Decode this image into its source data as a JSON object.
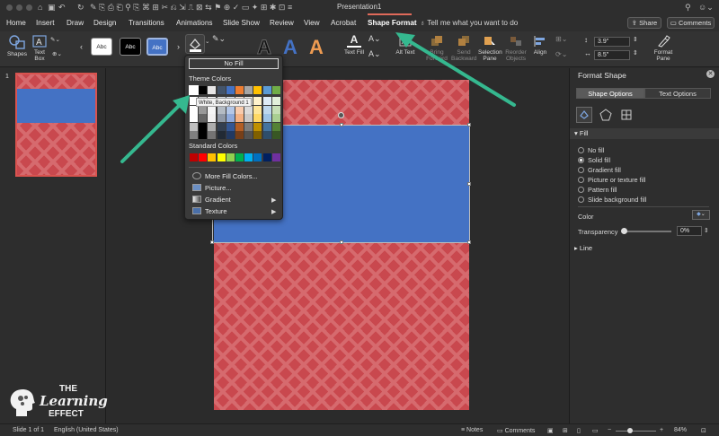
{
  "window": {
    "title": "Presentation1"
  },
  "menu": {
    "items": [
      "Home",
      "Insert",
      "Draw",
      "Design",
      "Transitions",
      "Animations",
      "Slide Show",
      "Review",
      "View",
      "Acrobat",
      "Shape Format"
    ],
    "active": "Shape Format",
    "tell_me": "Tell me what you want to do",
    "share": "Share",
    "comments": "Comments"
  },
  "ribbon": {
    "shapes": "Shapes",
    "text_box": "Text Box",
    "style_sample": "Abc",
    "text_fill": "Text Fill",
    "alt_text": "Alt Text",
    "bring_forward": "Bring Forward",
    "send_backward": "Send Backward",
    "selection_pane": "Selection Pane",
    "reorder_objects": "Reorder Objects",
    "align": "Align",
    "height": "3.9\"",
    "width": "8.5\"",
    "format_pane": "Format Pane"
  },
  "thumbnail": {
    "number": "1"
  },
  "fill_dropdown": {
    "no_fill": "No Fill",
    "theme_colors_label": "Theme Colors",
    "tooltip": "White, Background 1",
    "standard_colors_label": "Standard Colors",
    "theme_top_row": [
      "#ffffff",
      "#000000",
      "#e7e6e6",
      "#44546a",
      "#4472c4",
      "#ed7d31",
      "#a5a5a5",
      "#ffc000",
      "#5b9bd5",
      "#70ad47"
    ],
    "standard_colors": [
      "#c00000",
      "#ff0000",
      "#ffc000",
      "#ffff00",
      "#92d050",
      "#00b050",
      "#00b0f0",
      "#0070c0",
      "#002060",
      "#7030a0"
    ],
    "more_colors": "More Fill Colors...",
    "picture": "Picture...",
    "gradient": "Gradient",
    "texture": "Texture"
  },
  "format_pane": {
    "title": "Format Shape",
    "tab_shape": "Shape Options",
    "tab_text": "Text Options",
    "fill_section": "Fill",
    "options": [
      "No fill",
      "Solid fill",
      "Gradient fill",
      "Picture or texture fill",
      "Pattern fill",
      "Slide background fill"
    ],
    "selected_option": "Solid fill",
    "color_label": "Color",
    "transparency_label": "Transparency",
    "transparency_value": "0%",
    "line_section": "Line"
  },
  "status": {
    "slide": "Slide 1 of 1",
    "language": "English (United States)",
    "notes": "Notes",
    "comments": "Comments",
    "zoom": "84%"
  },
  "logo": {
    "line1": "THE",
    "line2": "Learning",
    "line3": "EFFECT"
  },
  "colors": {
    "slide_red": "#c9484e",
    "shape_blue": "#4472c4",
    "arrow": "#35b88f"
  }
}
